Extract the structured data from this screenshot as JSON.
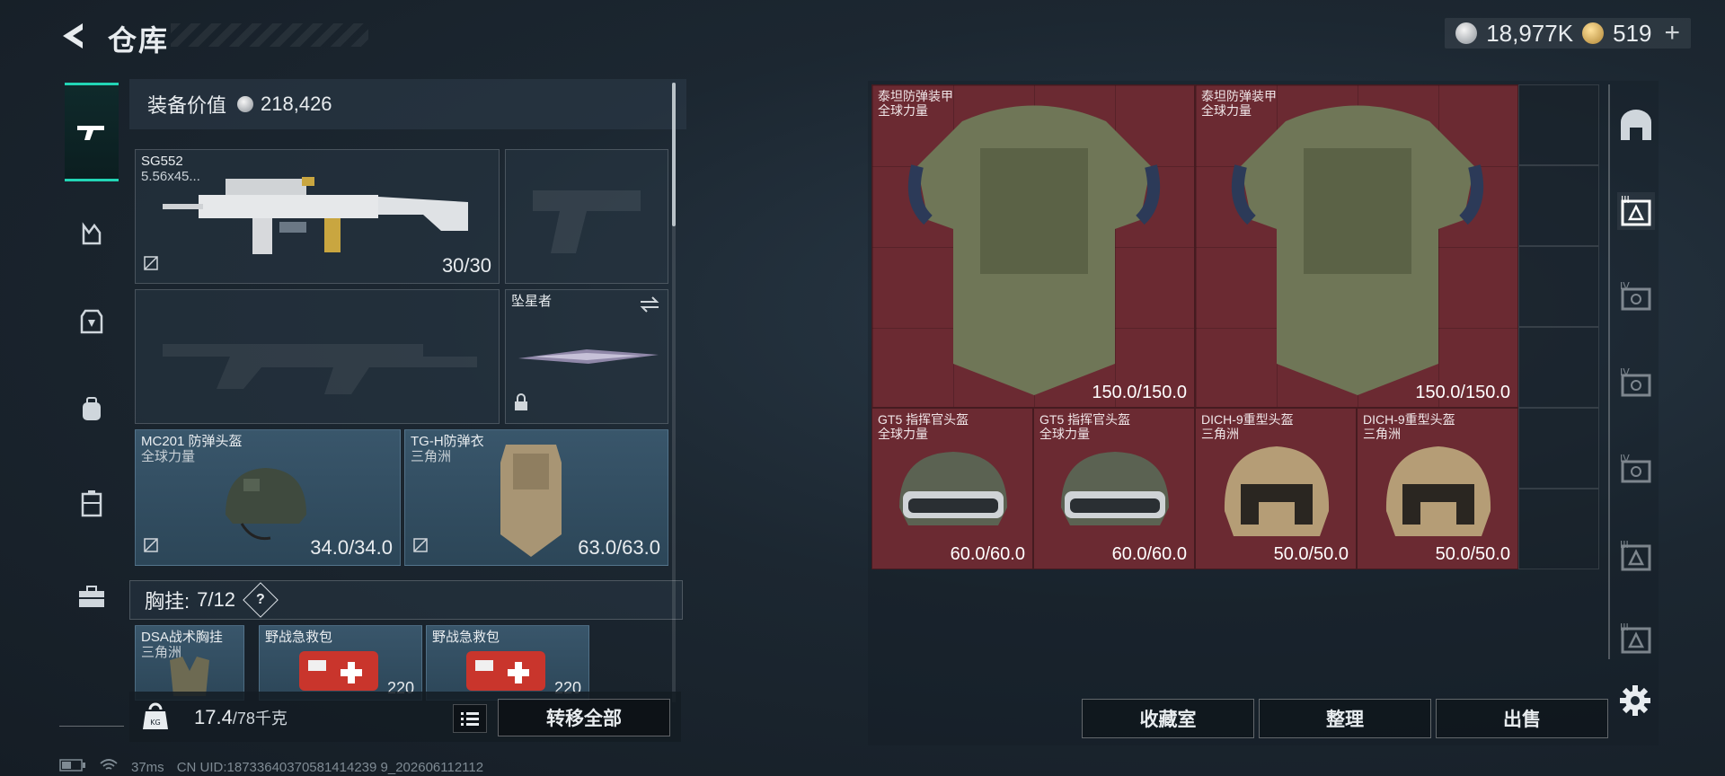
{
  "header": {
    "title": "仓库"
  },
  "currency": {
    "silver": "18,977K",
    "gold": "519",
    "plus": "+"
  },
  "equipment": {
    "value_label": "装备价值",
    "value": "218,426",
    "primary": {
      "name": "SG552",
      "ammo": "5.56x45...",
      "durability": "30/30"
    },
    "melee": {
      "name": "坠星者"
    },
    "helmet": {
      "name": "MC201 防弹头盔",
      "origin": "全球力量",
      "durability": "34.0/34.0"
    },
    "armor": {
      "name": "TG-H防弹衣",
      "origin": "三角洲",
      "durability": "63.0/63.0"
    },
    "rig": {
      "label": "胸挂:",
      "count": "7/12",
      "help": "?"
    },
    "rig_items": [
      {
        "name": "DSA战术胸挂",
        "origin": "三角洲"
      },
      {
        "name": "野战急救包",
        "value": "220"
      },
      {
        "name": "野战急救包",
        "value": "220"
      }
    ]
  },
  "footer": {
    "weight": "17.4",
    "weight_max": "/78千克",
    "transfer_all": "转移全部"
  },
  "stash": {
    "items": [
      {
        "name": "泰坦防弹装甲",
        "origin": "全球力量",
        "durability": "150.0/150.0"
      },
      {
        "name": "泰坦防弹装甲",
        "origin": "全球力量",
        "durability": "150.0/150.0"
      },
      {
        "name": "GT5 指挥官头盔",
        "origin": "全球力量",
        "durability": "60.0/60.0"
      },
      {
        "name": "GT5 指挥官头盔",
        "origin": "全球力量",
        "durability": "60.0/60.0"
      },
      {
        "name": "DICH-9重型头盔",
        "origin": "三角洲",
        "durability": "50.0/50.0"
      },
      {
        "name": "DICH-9重型头盔",
        "origin": "三角洲",
        "durability": "50.0/50.0"
      }
    ]
  },
  "actions": {
    "collection": "收藏室",
    "organize": "整理",
    "sell": "出售"
  },
  "right_tabs": [
    "III",
    "IV",
    "IV",
    "IV",
    "III",
    "III"
  ],
  "status": {
    "ping": "37ms",
    "uid": "CN UID:18733640370581414239 9_202606112112"
  },
  "colors": {
    "accent": "#22d5b5",
    "item_bg": "#6b2a32"
  }
}
